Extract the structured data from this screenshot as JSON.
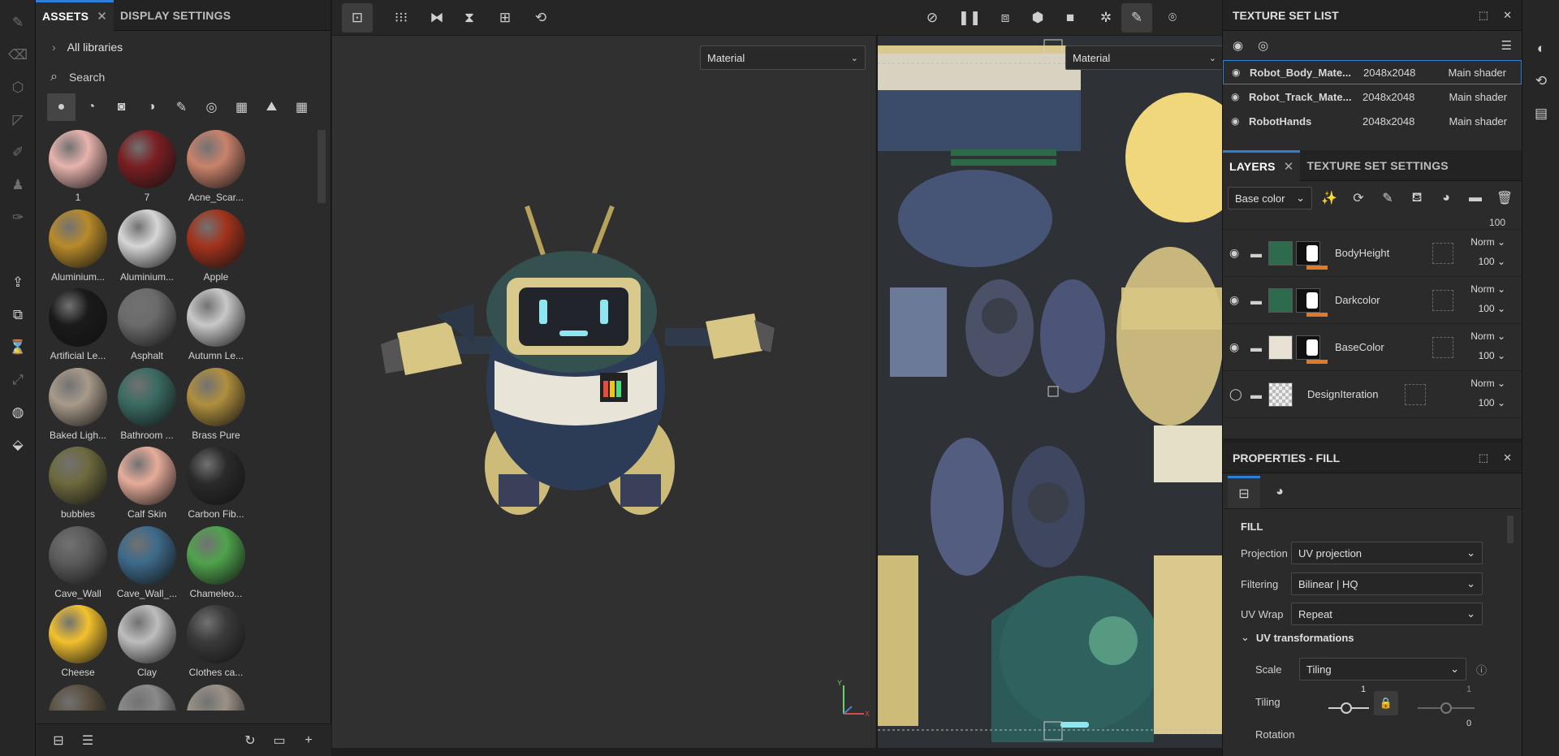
{
  "assets_panel": {
    "tab_assets": "ASSETS",
    "tab_display": "DISPLAY SETTINGS",
    "all_libraries": "All libraries",
    "search_placeholder": "Search",
    "items": [
      {
        "label": "1",
        "color": "#e7b3ad"
      },
      {
        "label": "7",
        "color": "#7a1f22"
      },
      {
        "label": "Acne_Scar...",
        "color": "#c9826b"
      },
      {
        "label": "Aluminium...",
        "color": "#b88a2a"
      },
      {
        "label": "Aluminium...",
        "color": "#d6d6d6"
      },
      {
        "label": "Apple",
        "color": "#a3331c"
      },
      {
        "label": "Artificial Le...",
        "color": "#1a1a1a"
      },
      {
        "label": "Asphalt",
        "color": "#6b6b6b"
      },
      {
        "label": "Autumn Le...",
        "color": "#c8c8c8"
      },
      {
        "label": "Baked Ligh...",
        "color": "#a89a8a"
      },
      {
        "label": "Bathroom ...",
        "color": "#3a6b63"
      },
      {
        "label": "Brass Pure",
        "color": "#b08f3d"
      },
      {
        "label": "bubbles",
        "color": "#6d6a3e"
      },
      {
        "label": "Calf Skin",
        "color": "#e6ac9a"
      },
      {
        "label": "Carbon Fib...",
        "color": "#2a2a2a"
      },
      {
        "label": "Cave_Wall",
        "color": "#5b5b5b"
      },
      {
        "label": "Cave_Wall_...",
        "color": "#3d6a8a"
      },
      {
        "label": "Chameleo...",
        "color": "#4fa34d"
      },
      {
        "label": "Cheese",
        "color": "#f2c12e"
      },
      {
        "label": "Clay",
        "color": "#bdbdbd"
      },
      {
        "label": "Clothes ca...",
        "color": "#3a3a3a"
      },
      {
        "label": "",
        "color": "#5a5040"
      },
      {
        "label": "",
        "color": "#8a8a8a"
      },
      {
        "label": "",
        "color": "#9a9288"
      }
    ]
  },
  "viewport": {
    "dropdown_left": "Material",
    "dropdown_right": "Material",
    "axis_y": "Y",
    "axis_x": "X"
  },
  "texture_set_list": {
    "title": "TEXTURE SET LIST",
    "rows": [
      {
        "name": "Robot_Body_Mate...",
        "res": "2048x2048",
        "shader": "Main shader"
      },
      {
        "name": "Robot_Track_Mate...",
        "res": "2048x2048",
        "shader": "Main shader"
      },
      {
        "name": "RobotHands",
        "res": "2048x2048",
        "shader": "Main shader"
      }
    ]
  },
  "layers": {
    "tab_layers": "LAYERS",
    "tab_tss": "TEXTURE SET SETTINGS",
    "channel": "Base color",
    "top_opacity": "100",
    "rows": [
      {
        "name": "BodyHeight",
        "blend": "Norm",
        "opacity": "100"
      },
      {
        "name": "Darkcolor",
        "blend": "Norm",
        "opacity": "100"
      },
      {
        "name": "BaseColor",
        "blend": "Norm",
        "opacity": "100"
      },
      {
        "name": "DesignIteration",
        "blend": "Norm",
        "opacity": "100"
      }
    ]
  },
  "properties": {
    "title": "PROPERTIES - FILL",
    "section": "FILL",
    "projection_label": "Projection",
    "projection_value": "UV projection",
    "filtering_label": "Filtering",
    "filtering_value": "Bilinear | HQ",
    "uvwrap_label": "UV Wrap",
    "uvwrap_value": "Repeat",
    "uvtrans_label": "UV transformations",
    "scale_label": "Scale",
    "scale_value": "Tiling",
    "tiling_label": "Tiling",
    "tiling_value_1": "1",
    "tiling_value_2": "1",
    "rotation_label": "Rotation",
    "rotation_value": "0"
  },
  "colors": {
    "accent": "#2d7fd8",
    "orange": "#e07a27"
  }
}
